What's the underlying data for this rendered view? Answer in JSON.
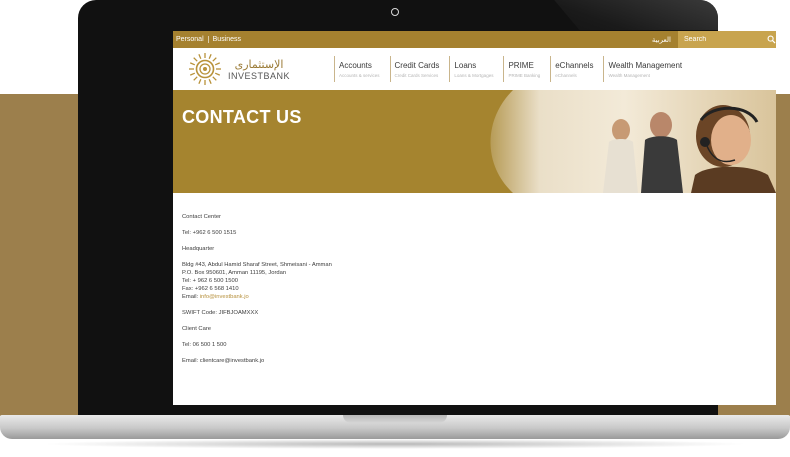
{
  "topbar": {
    "personal": "Personal",
    "business": "Business",
    "arabic": "العربية",
    "search_placeholder": "Search"
  },
  "logo": {
    "arabic": "الإستثمارى",
    "english": "INVESTBANK"
  },
  "nav": {
    "items": [
      {
        "label": "Accounts",
        "sub": "Accounts & services"
      },
      {
        "label": "Credit Cards",
        "sub": "Credit Cards Services"
      },
      {
        "label": "Loans",
        "sub": "Loans & Mortgages"
      },
      {
        "label": "PRIME",
        "sub": "PRIME Banking"
      },
      {
        "label": "eChannels",
        "sub": "eChannels"
      },
      {
        "label": "Wealth Management",
        "sub": "Wealth Management"
      }
    ]
  },
  "hero": {
    "title": "CONTACT US"
  },
  "contact": {
    "contact_center": "Contact Center",
    "contact_center_tel": "Tel: +962 6 500 1515",
    "headquarter": "Headquarter",
    "address": "Bldg #43, Abdul Hamid Sharaf Street, Shmeisani - Amman",
    "po_box": "P.O. Box 950601, Amman 11195, Jordan",
    "tel": "Tel: + 962 6 500 1500",
    "fax": "Fax: +962 6 568 1410",
    "email_label": "Email: ",
    "email": "info@investbank.jo",
    "swift": "SWIFT Code: JIFBJOAMXXX",
    "client_care": "Client Care",
    "client_care_tel": "Tel: 06 500 1 500",
    "client_care_email": "Email: clientcare@investbank.jo"
  },
  "colors": {
    "brand_gold": "#a5812f",
    "backdrop": "#9c7f4c",
    "link": "#b7913d"
  },
  "icons": [
    "search-icon",
    "camera-icon",
    "logo-sunburst-icon"
  ]
}
